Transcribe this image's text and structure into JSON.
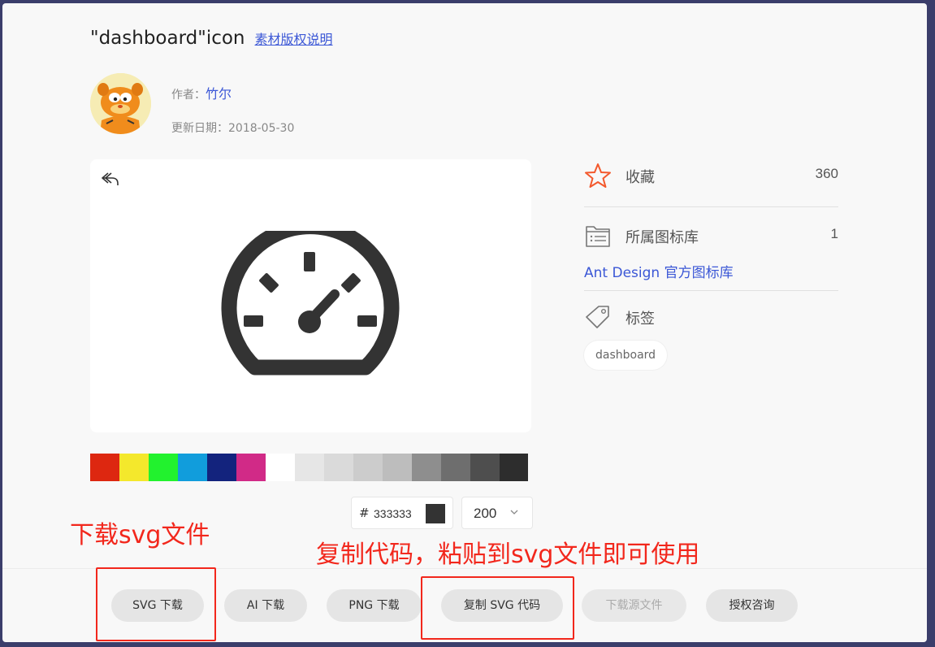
{
  "header": {
    "title": "\"dashboard\"icon",
    "copyright_link": "素材版权说明"
  },
  "author": {
    "label": "作者：",
    "name": "竹尔",
    "date_label": "更新日期：",
    "date": "2018-05-30"
  },
  "palette": [
    "#dd2710",
    "#f4e82c",
    "#22f22e",
    "#119ddc",
    "#13237d",
    "#d12a87",
    "#ffffff",
    "#e6e6e6",
    "#dadada",
    "#cccccc",
    "#bdbdbd",
    "#8e8e8e",
    "#6e6e6e",
    "#4e4e4e",
    "#2d2d2d"
  ],
  "color_input": {
    "hash": "#",
    "value": "333333"
  },
  "size_select": {
    "value": "200"
  },
  "sidebar": {
    "favorite_label": "收藏",
    "favorite_count": "360",
    "library_label": "所属图标库",
    "library_count": "1",
    "library_link": "Ant Design 官方图标库",
    "tags_label": "标签",
    "tag": "dashboard"
  },
  "annotations": {
    "note_download": "下载svg文件",
    "note_copy": "复制代码，粘贴到svg文件即可使用"
  },
  "buttons": {
    "svg_download": "SVG 下载",
    "ai_download": "AI 下载",
    "png_download": "PNG 下载",
    "copy_svg": "复制 SVG 代码",
    "source_download": "下载源文件",
    "license": "授权咨询"
  }
}
